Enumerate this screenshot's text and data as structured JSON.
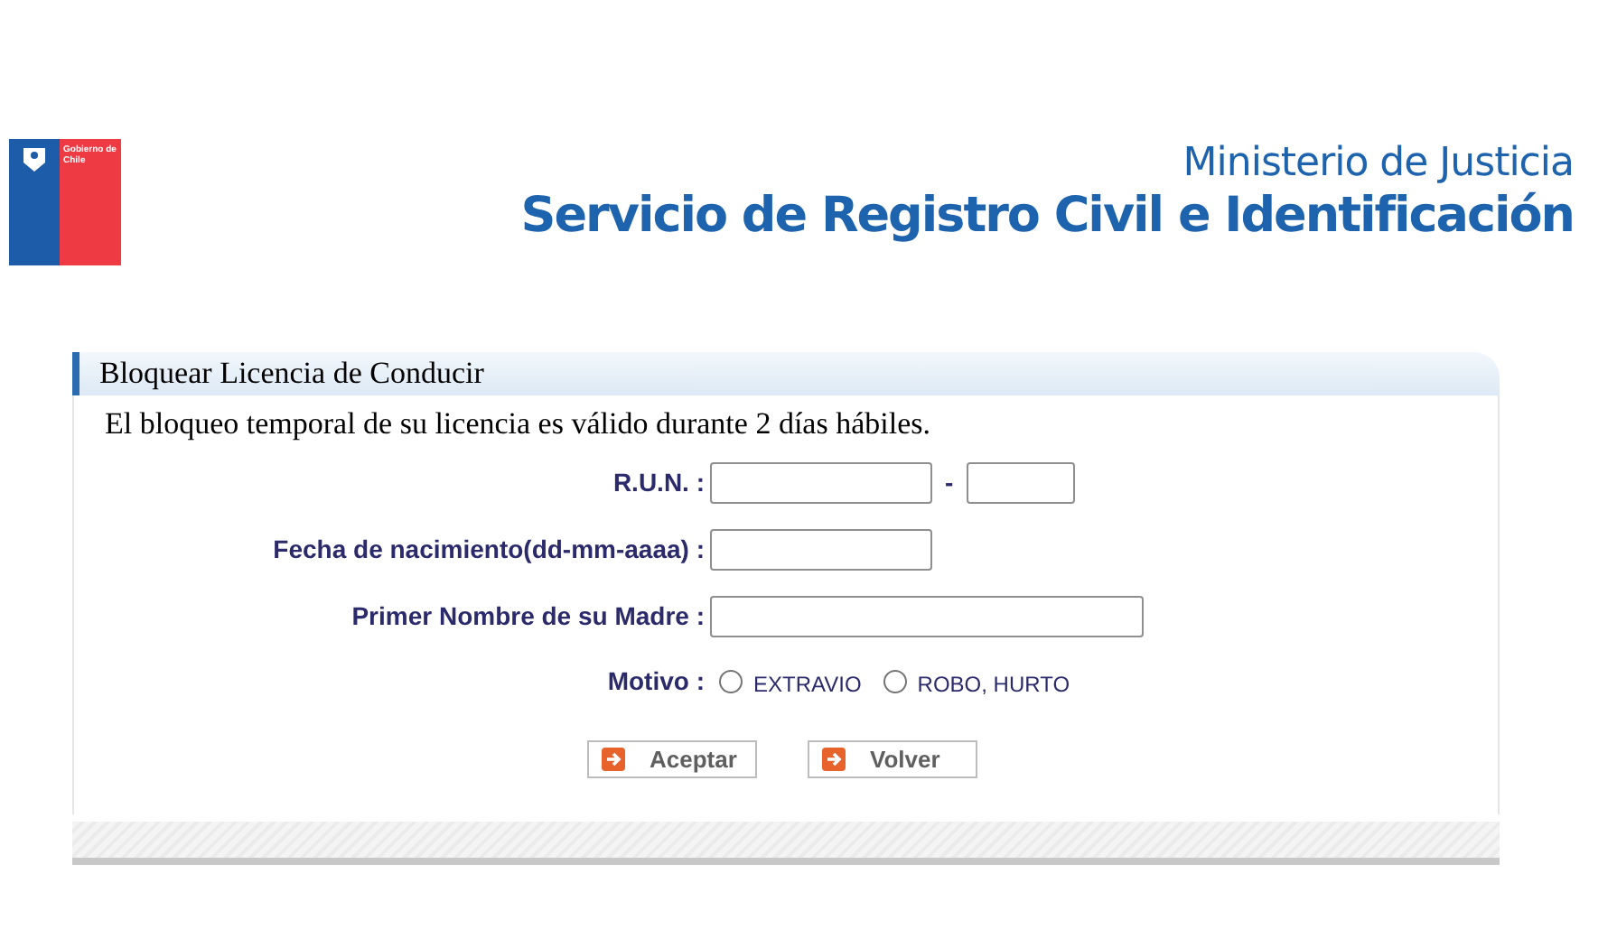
{
  "logo": {
    "text": "Gobierno de Chile"
  },
  "header": {
    "ministry": "Ministerio de Justicia",
    "service": "Servicio de Registro Civil e Identificación"
  },
  "panel": {
    "title": "Bloquear Licencia de Conducir",
    "intro": "El bloqueo temporal de su licencia es válido durante 2 días hábiles.",
    "run": {
      "label": "R.U.N. :",
      "separator": "-"
    },
    "birth": {
      "label": "Fecha de nacimiento(dd-mm-aaaa) :"
    },
    "mother": {
      "label": "Primer Nombre de su Madre :"
    },
    "motivo": {
      "label": "Motivo :",
      "options": [
        {
          "label": "EXTRAVIO",
          "selected": false
        },
        {
          "label": "ROBO, HURTO",
          "selected": false
        }
      ]
    },
    "buttons": [
      "Aceptar",
      "Volver"
    ]
  }
}
